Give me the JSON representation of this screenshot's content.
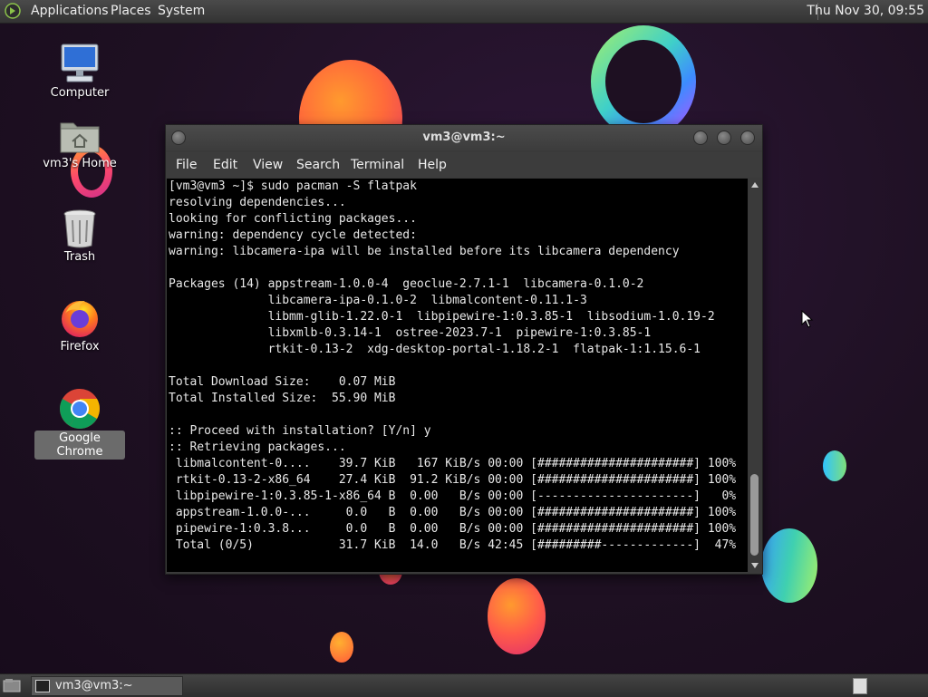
{
  "top_panel": {
    "menus": [
      "Applications",
      "Places",
      "System"
    ],
    "clock": "Thu Nov 30, 09:55"
  },
  "desktop_icons": [
    {
      "label": "Computer",
      "icon": "computer-icon"
    },
    {
      "label": "vm3's Home",
      "icon": "home-folder-icon"
    },
    {
      "label": "Trash",
      "icon": "trash-icon"
    },
    {
      "label": "Firefox",
      "icon": "firefox-icon"
    },
    {
      "label": "Google Chrome",
      "icon": "chrome-icon",
      "selected": true
    }
  ],
  "terminal": {
    "title": "vm3@vm3:~",
    "menus": [
      "File",
      "Edit",
      "View",
      "Search",
      "Terminal",
      "Help"
    ],
    "lines": [
      "[vm3@vm3 ~]$ sudo pacman -S flatpak",
      "resolving dependencies...",
      "looking for conflicting packages...",
      "warning: dependency cycle detected:",
      "warning: libcamera-ipa will be installed before its libcamera dependency",
      "",
      "Packages (14) appstream-1.0.0-4  geoclue-2.7.1-1  libcamera-0.1.0-2",
      "              libcamera-ipa-0.1.0-2  libmalcontent-0.11.1-3",
      "              libmm-glib-1.22.0-1  libpipewire-1:0.3.85-1  libsodium-1.0.19-2",
      "              libxmlb-0.3.14-1  ostree-2023.7-1  pipewire-1:0.3.85-1",
      "              rtkit-0.13-2  xdg-desktop-portal-1.18.2-1  flatpak-1:1.15.6-1",
      "",
      "Total Download Size:    0.07 MiB",
      "Total Installed Size:  55.90 MiB",
      "",
      ":: Proceed with installation? [Y/n] y",
      ":: Retrieving packages...",
      " libmalcontent-0....    39.7 KiB   167 KiB/s 00:00 [######################] 100%",
      " rtkit-0.13-2-x86_64    27.4 KiB  91.2 KiB/s 00:00 [######################] 100%",
      " libpipewire-1:0.3.85-1-x86_64 B  0.00   B/s 00:00 [----------------------]   0%",
      " appstream-1.0.0-...     0.0   B  0.00   B/s 00:00 [######################] 100%",
      " pipewire-1:0.3.8...     0.0   B  0.00   B/s 00:00 [######################] 100%",
      " Total (0/5)            31.7 KiB  14.0   B/s 42:45 [#########-------------]  47%"
    ]
  },
  "taskbar": {
    "task_label": "vm3@vm3:~"
  },
  "colors": {
    "desktop_bg": "#1e1022",
    "panel_bg": "#3a3a3a",
    "terminal_bg": "#000000",
    "terminal_fg": "#e8e8e8"
  }
}
